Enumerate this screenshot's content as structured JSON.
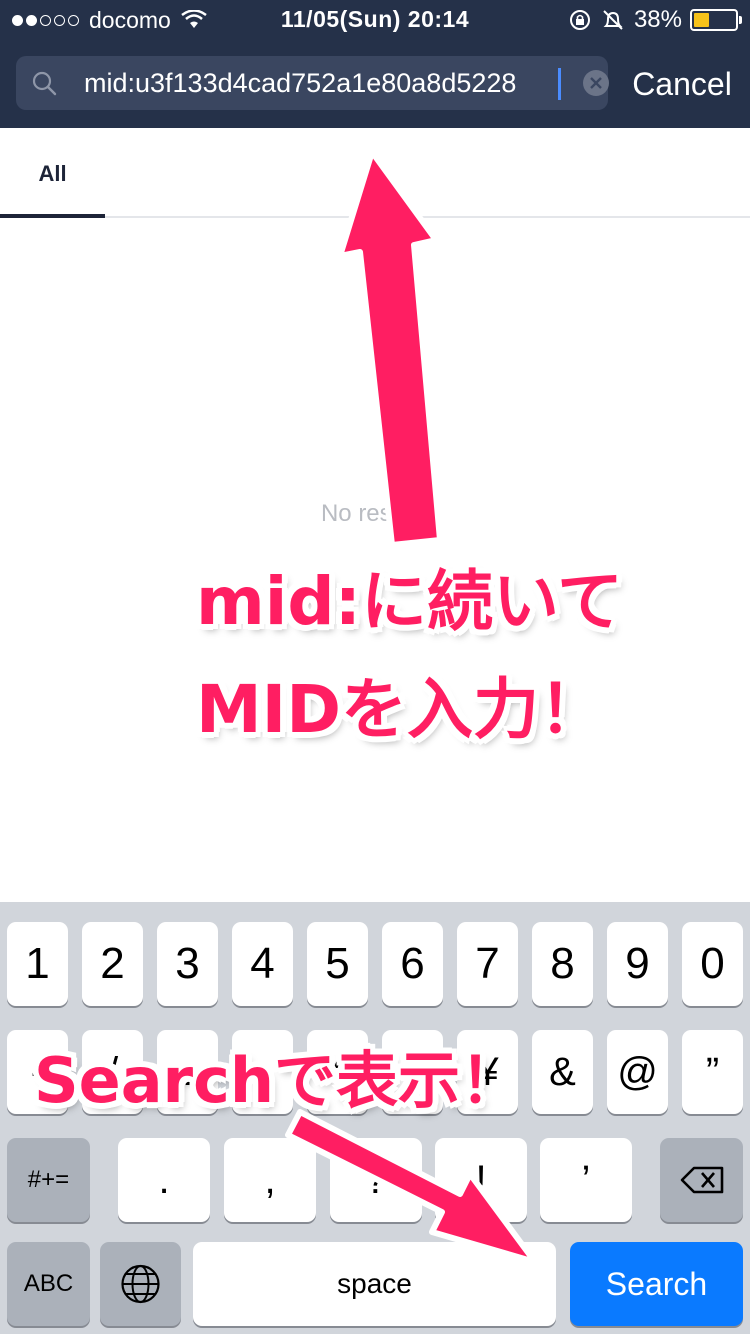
{
  "status_bar": {
    "carrier": "docomo",
    "time": "11/05(Sun) 20:14",
    "battery_percent": "38%",
    "battery_level": 0.38
  },
  "search": {
    "query": "mid:u3f133d4cad752a1e80a8d5228",
    "cancel_label": "Cancel"
  },
  "tabs": [
    {
      "label": "All"
    }
  ],
  "results": {
    "empty_text": "No results"
  },
  "annotations": {
    "line1": "mid:に続いて",
    "line2": "MIDを入力！",
    "line3": "Searchで表示！"
  },
  "keyboard": {
    "row1": [
      "1",
      "2",
      "3",
      "4",
      "5",
      "6",
      "7",
      "8",
      "9",
      "0"
    ],
    "row2": [
      "-",
      "/",
      ":",
      ";",
      "(",
      ")",
      "¥",
      "&",
      "@",
      "”"
    ],
    "row3": [
      ".",
      ",",
      "?",
      "!",
      "’"
    ],
    "shift_label": "#+=",
    "abc_label": "ABC",
    "space_label": "space",
    "search_label": "Search"
  }
}
